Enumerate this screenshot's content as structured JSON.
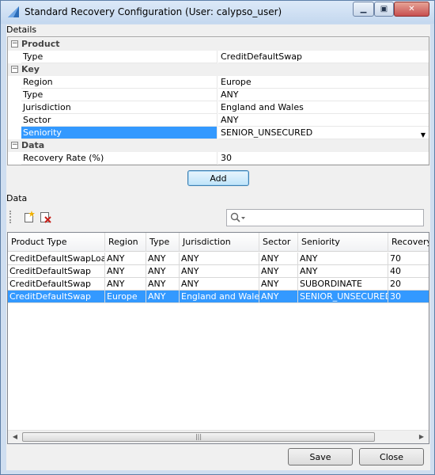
{
  "window": {
    "title": "Standard Recovery Configuration (User: calypso_user)"
  },
  "details": {
    "label": "Details",
    "categories": [
      {
        "name": "Product",
        "items": [
          {
            "name": "Type",
            "value": "CreditDefaultSwap"
          }
        ]
      },
      {
        "name": "Key",
        "items": [
          {
            "name": "Region",
            "value": "Europe"
          },
          {
            "name": "Type",
            "value": "ANY"
          },
          {
            "name": "Jurisdiction",
            "value": "England and Wales"
          },
          {
            "name": "Sector",
            "value": "ANY"
          },
          {
            "name": "Seniority",
            "value": "SENIOR_UNSECURED"
          }
        ]
      },
      {
        "name": "Data",
        "items": [
          {
            "name": "Recovery Rate (%)",
            "value": "30"
          }
        ]
      }
    ],
    "add_label": "Add"
  },
  "data_section": {
    "label": "Data",
    "search": {
      "value": "",
      "placeholder": ""
    },
    "columns": [
      "Product Type",
      "Region",
      "Type",
      "Jurisdiction",
      "Sector",
      "Seniority",
      "Recovery"
    ],
    "rows": [
      [
        "CreditDefaultSwapLoan",
        "ANY",
        "ANY",
        "ANY",
        "ANY",
        "ANY",
        "70"
      ],
      [
        "CreditDefaultSwap",
        "ANY",
        "ANY",
        "ANY",
        "ANY",
        "ANY",
        "40"
      ],
      [
        "CreditDefaultSwap",
        "ANY",
        "ANY",
        "ANY",
        "ANY",
        "SUBORDINATE",
        "20"
      ],
      [
        "CreditDefaultSwap",
        "Europe",
        "ANY",
        "England and Wales",
        "ANY",
        "SENIOR_UNSECURED",
        "30"
      ]
    ],
    "selected_row": 3,
    "scroll_grip": "|||"
  },
  "footer": {
    "save_label": "Save",
    "close_label": "Close"
  },
  "colors": {
    "selection": "#3399ff",
    "title_bar": "#c4d8ef",
    "close_button": "#c75050"
  }
}
